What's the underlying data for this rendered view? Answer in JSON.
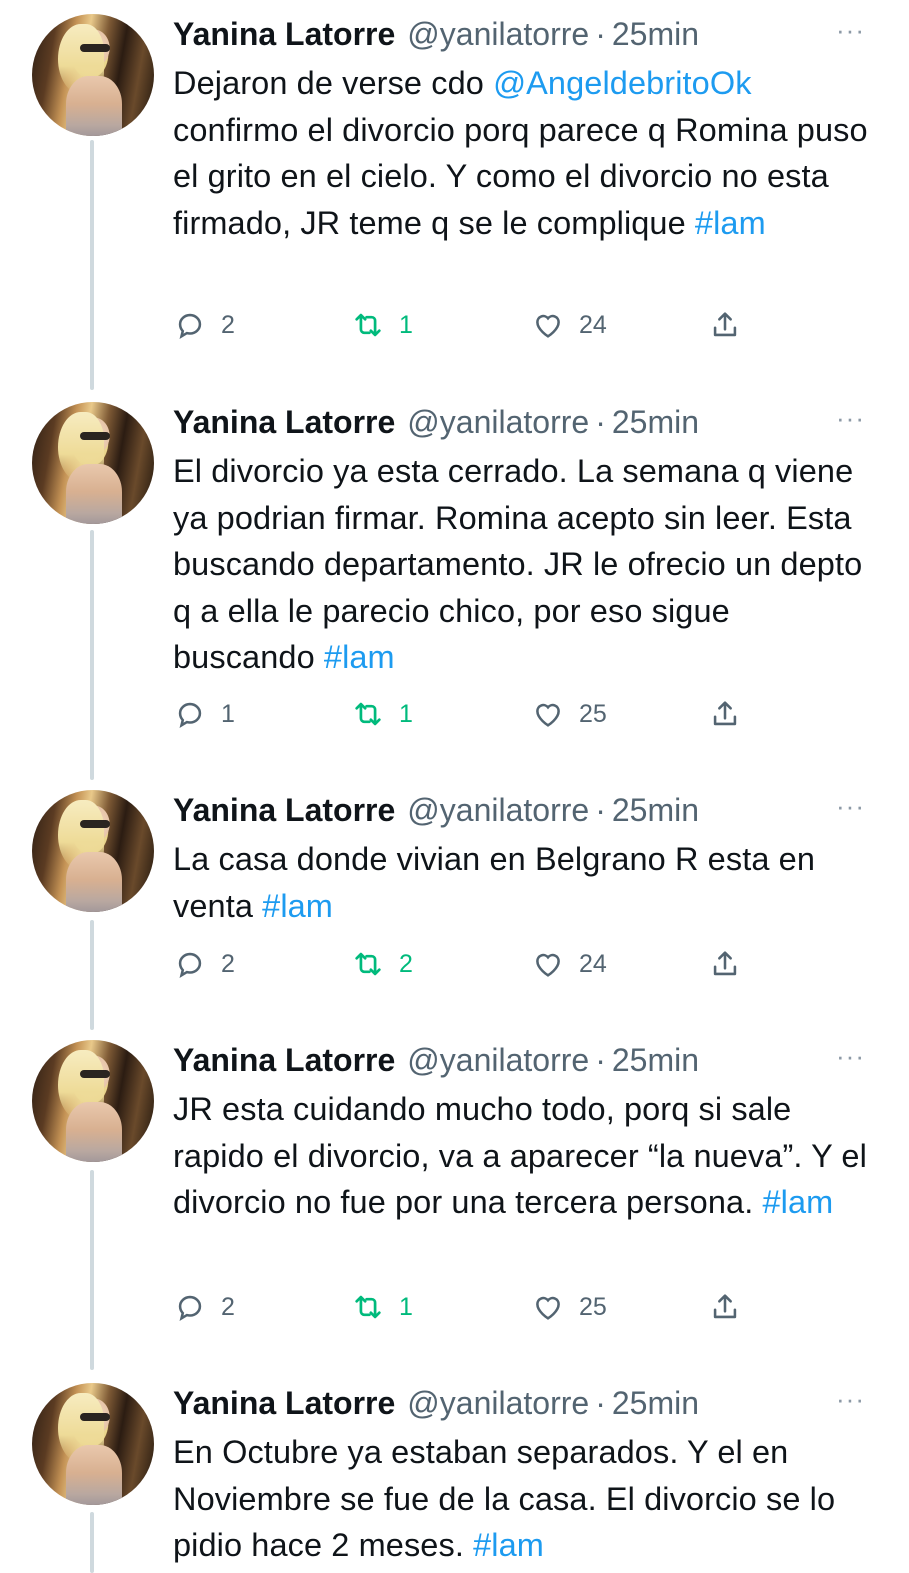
{
  "tweets": [
    {
      "name": "Yanina Latorre",
      "handle": "@yanilatorre",
      "separator": "·",
      "time": "25min",
      "more": "···",
      "text_parts": [
        {
          "t": "Dejaron de verse cdo ",
          "kind": "text"
        },
        {
          "t": "@AngeldebritoOk",
          "kind": "mention"
        },
        {
          "t": " confirmo el divorcio porq parece q Romina puso el grito en el cielo. Y como el divorcio no esta firmado, JR teme q se le complique ",
          "kind": "text"
        },
        {
          "t": "#lam",
          "kind": "hashtag"
        }
      ],
      "replies": "2",
      "retweets": "1",
      "likes": "24"
    },
    {
      "name": "Yanina Latorre",
      "handle": "@yanilatorre",
      "separator": "·",
      "time": "25min",
      "more": "···",
      "text_parts": [
        {
          "t": "El divorcio ya esta cerrado. La semana q viene ya podrian firmar. Romina acepto sin leer. Esta buscando departamento. JR le ofrecio un depto q a ella le parecio chico, por eso sigue buscando ",
          "kind": "text"
        },
        {
          "t": "#lam",
          "kind": "hashtag"
        }
      ],
      "replies": "1",
      "retweets": "1",
      "likes": "25"
    },
    {
      "name": "Yanina Latorre",
      "handle": "@yanilatorre",
      "separator": "·",
      "time": "25min",
      "more": "···",
      "text_parts": [
        {
          "t": "La casa donde vivian en Belgrano R esta en venta ",
          "kind": "text"
        },
        {
          "t": "#lam",
          "kind": "hashtag"
        }
      ],
      "replies": "2",
      "retweets": "2",
      "likes": "24"
    },
    {
      "name": "Yanina Latorre",
      "handle": "@yanilatorre",
      "separator": "·",
      "time": "25min",
      "more": "···",
      "text_parts": [
        {
          "t": "JR esta cuidando mucho todo, porq si sale rapido el divorcio, va a aparecer “la nueva”. Y el divorcio no fue por una tercera persona. ",
          "kind": "text"
        },
        {
          "t": "#lam",
          "kind": "hashtag"
        }
      ],
      "replies": "2",
      "retweets": "1",
      "likes": "25"
    },
    {
      "name": "Yanina Latorre",
      "handle": "@yanilatorre",
      "separator": "·",
      "time": "25min",
      "more": "···",
      "text_parts": [
        {
          "t": "En Octubre ya estaban separados. Y el en Noviembre se fue de la casa. El divorcio se lo pidio hace 2 meses. ",
          "kind": "text"
        },
        {
          "t": "#lam",
          "kind": "hashtag"
        }
      ],
      "replies": null,
      "retweets": null,
      "likes": null
    }
  ],
  "icons": {
    "reply": "reply-icon",
    "retweet": "retweet-icon",
    "like": "heart-icon",
    "share": "share-icon",
    "more": "more-icon"
  },
  "colors": {
    "link": "#1d9bf0",
    "retweet": "#00ba7c",
    "muted": "#536471",
    "thread_line": "#cfd9de"
  }
}
